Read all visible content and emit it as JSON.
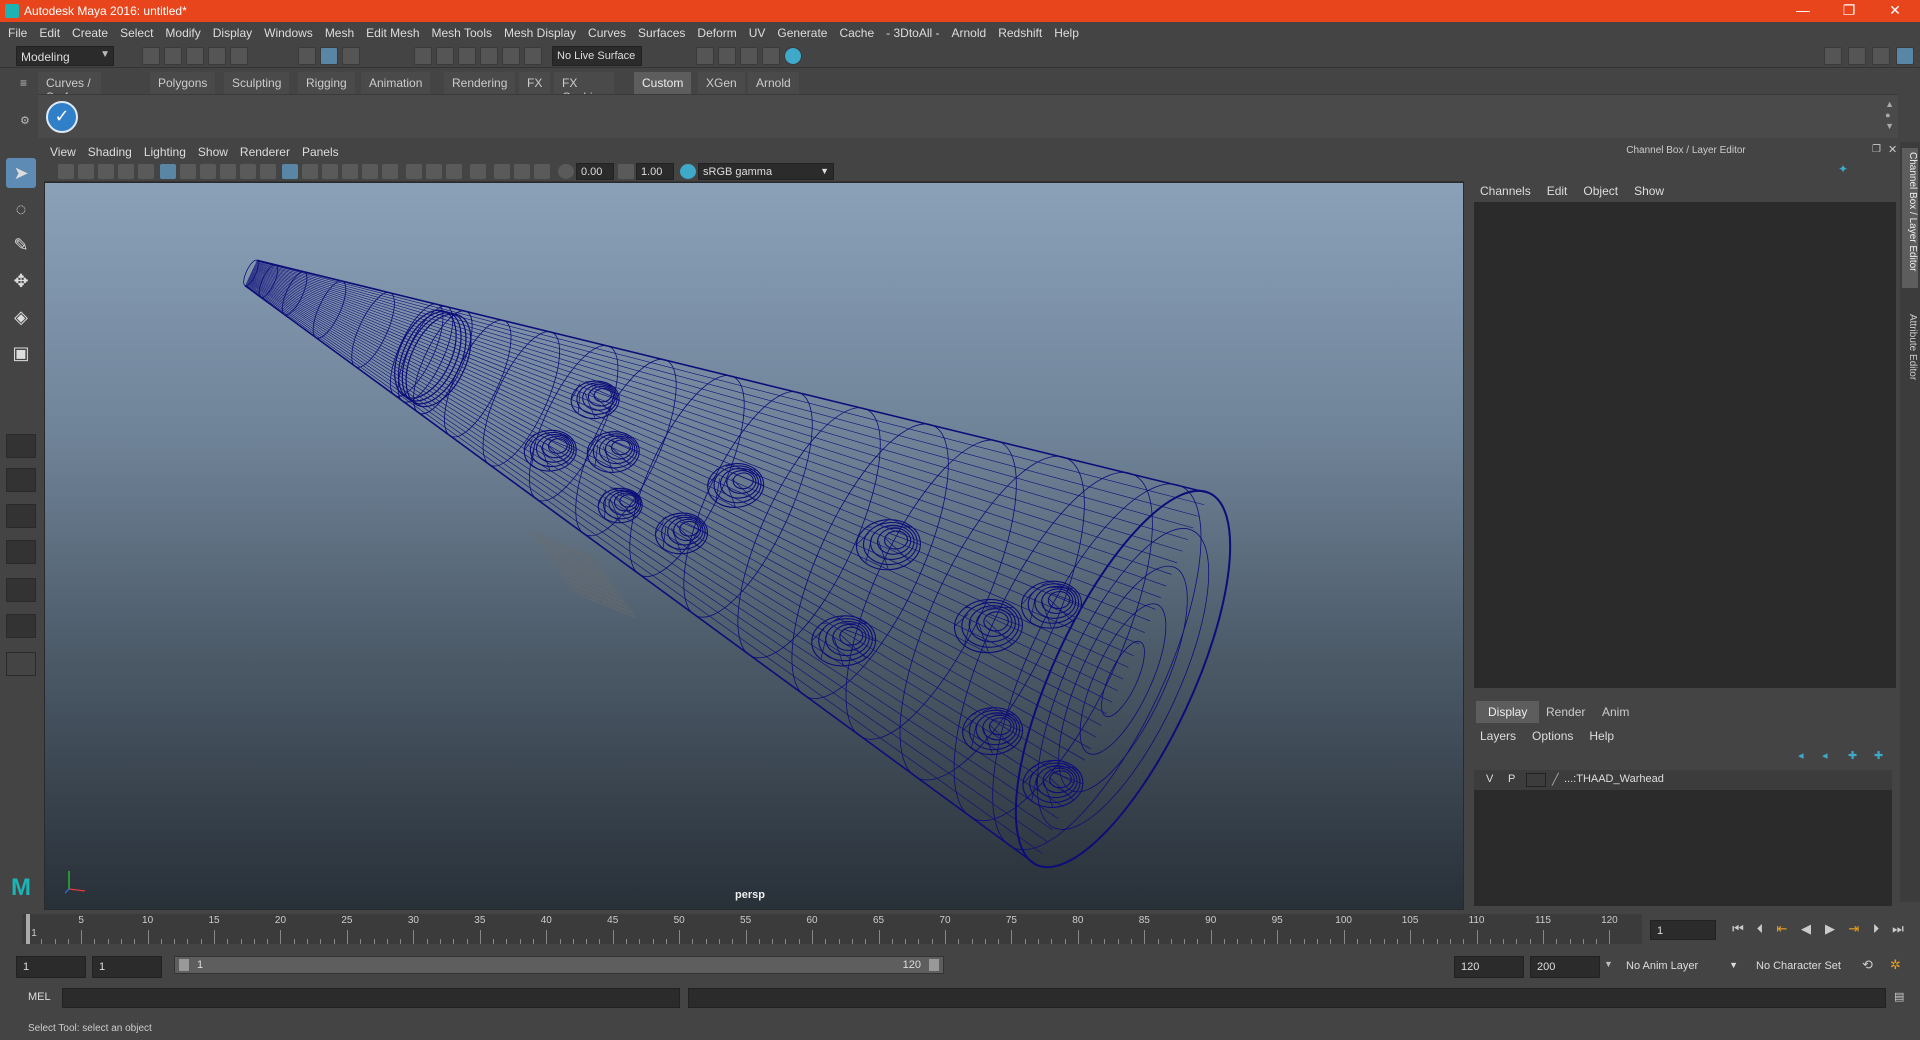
{
  "window": {
    "title": "Autodesk Maya 2016: untitled*",
    "minimize": "—",
    "maximize": "❐",
    "close": "✕"
  },
  "menubar": [
    "File",
    "Edit",
    "Create",
    "Select",
    "Modify",
    "Display",
    "Windows",
    "Mesh",
    "Edit Mesh",
    "Mesh Tools",
    "Mesh Display",
    "Curves",
    "Surfaces",
    "Deform",
    "UV",
    "Generate",
    "Cache",
    "- 3DtoAll -",
    "Arnold",
    "Redshift",
    "Help"
  ],
  "statusline": {
    "mode": "Modeling",
    "live_surface": "No Live Surface"
  },
  "shelf": {
    "tabs": [
      "Curves / Surfaces",
      "Polygons",
      "Sculpting",
      "Rigging",
      "Animation",
      "Rendering",
      "FX",
      "FX Caching",
      "Custom",
      "XGen",
      "Arnold"
    ],
    "active_tab": "Custom",
    "button_icon": "checkmark-icon"
  },
  "viewport": {
    "menu": [
      "View",
      "Shading",
      "Lighting",
      "Show",
      "Renderer",
      "Panels"
    ],
    "exposure": "0.00",
    "gamma": "1.00",
    "color_space": "sRGB gamma",
    "camera_label": "persp",
    "wire_color": "#0d0d7a"
  },
  "channel_box": {
    "header": "Channel Box / Layer Editor",
    "menu": [
      "Channels",
      "Edit",
      "Object",
      "Show"
    ]
  },
  "layer_editor": {
    "tabs": [
      "Display",
      "Render",
      "Anim"
    ],
    "active_tab": "Display",
    "menu": [
      "Layers",
      "Options",
      "Help"
    ],
    "layer": {
      "v": "V",
      "p": "P",
      "name": "...:THAAD_Warhead"
    }
  },
  "side_tabs": [
    "Channel Box / Layer Editor",
    "Attribute Editor"
  ],
  "timeline": {
    "labels": [
      "1",
      "5",
      "10",
      "15",
      "20",
      "25",
      "30",
      "35",
      "40",
      "45",
      "50",
      "55",
      "60",
      "65",
      "70",
      "75",
      "80",
      "85",
      "90",
      "95",
      "100",
      "105",
      "110",
      "115",
      "120"
    ],
    "current_frame": "1"
  },
  "range": {
    "start": "1",
    "anim_start": "1",
    "range_start": "1",
    "range_end": "120",
    "end": "120",
    "anim_end": "200",
    "anim_layer": "No Anim Layer",
    "character_set": "No Character Set"
  },
  "command_line": {
    "label": "MEL"
  },
  "help_line": "Select Tool: select an object"
}
